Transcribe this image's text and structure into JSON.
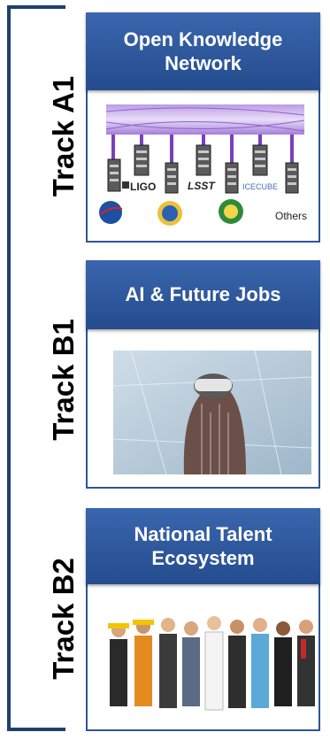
{
  "tracks": [
    {
      "label": "Track A1",
      "header": "Open Knowledge\nNetwork"
    },
    {
      "label": "Track B1",
      "header": "AI & Future Jobs"
    },
    {
      "label": "Track B2",
      "header": "National Talent\nEcosystem"
    }
  ],
  "okn_logos": {
    "ligo": "LIGO",
    "lsst": "LSST",
    "icecube": "ICECUBE",
    "others": "Others"
  },
  "colors": {
    "header": "#2f5a9e",
    "bracket": "#1f3f72",
    "network": "#7a3fbf"
  }
}
